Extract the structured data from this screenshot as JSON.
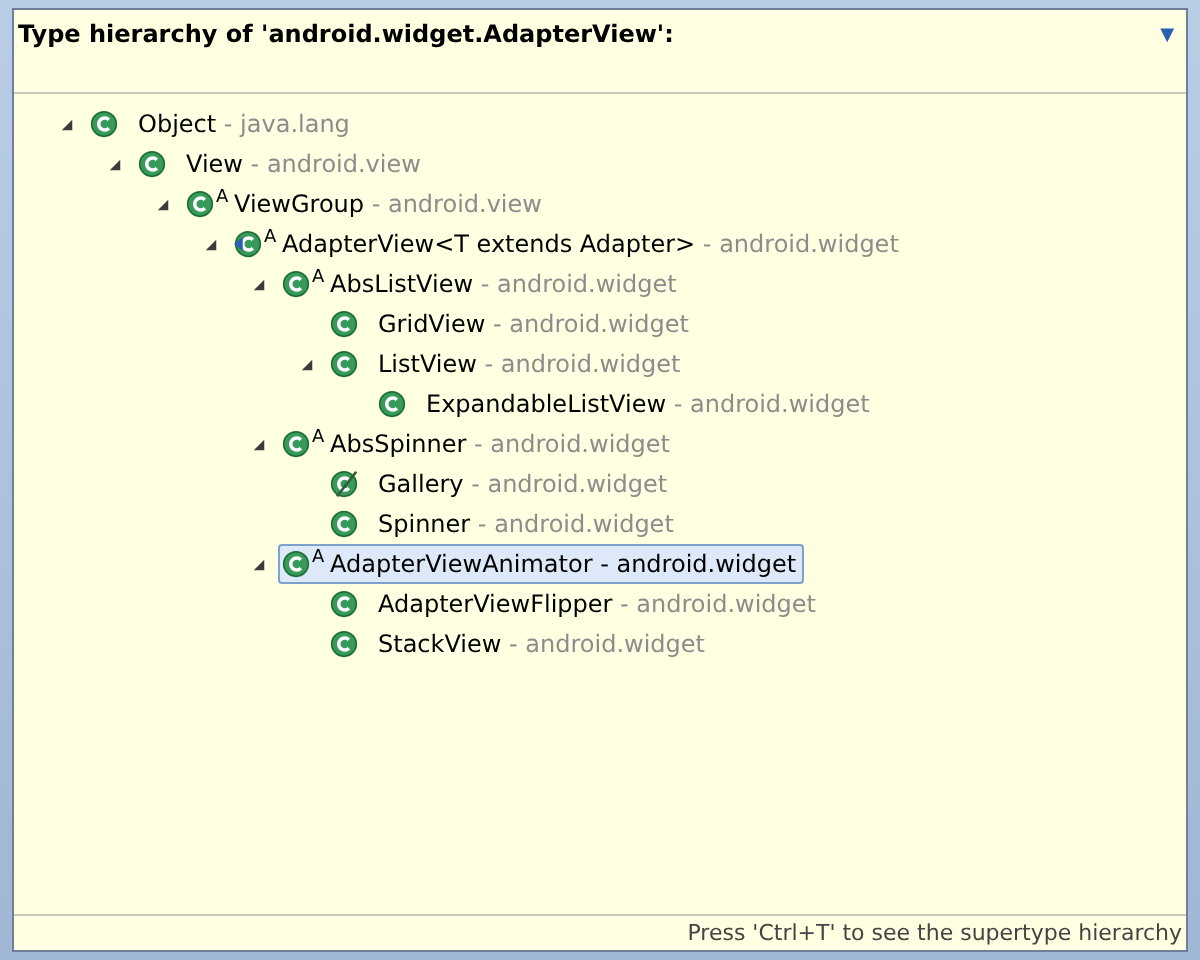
{
  "header": {
    "title": "Type hierarchy of 'android.widget.AdapterView':",
    "menu": "▼"
  },
  "tree": [
    {
      "name": "Object",
      "package": "java.lang",
      "kind": "class",
      "expanded": true,
      "selected": false,
      "children": [
        {
          "name": "View",
          "package": "android.view",
          "kind": "class",
          "expanded": true,
          "selected": false,
          "children": [
            {
              "name": "ViewGroup",
              "package": "android.view",
              "kind": "class",
              "abstract_mark": "A",
              "expanded": true,
              "selected": false,
              "children": [
                {
                  "name": "AdapterView<T extends Adapter>",
                  "package": "android.widget",
                  "kind": "focus",
                  "abstract_mark": "A",
                  "expanded": true,
                  "selected": false,
                  "children": [
                    {
                      "name": "AbsListView",
                      "package": "android.widget",
                      "kind": "class",
                      "abstract_mark": "A",
                      "expanded": true,
                      "selected": false,
                      "children": [
                        {
                          "name": "GridView",
                          "package": "android.widget",
                          "kind": "class",
                          "selected": false
                        },
                        {
                          "name": "ListView",
                          "package": "android.widget",
                          "kind": "class",
                          "expanded": true,
                          "selected": false,
                          "children": [
                            {
                              "name": "ExpandableListView",
                              "package": "android.widget",
                              "kind": "class",
                              "selected": false
                            }
                          ]
                        }
                      ]
                    },
                    {
                      "name": "AbsSpinner",
                      "package": "android.widget",
                      "kind": "class",
                      "abstract_mark": "A",
                      "expanded": true,
                      "selected": false,
                      "children": [
                        {
                          "name": "Gallery",
                          "package": "android.widget",
                          "kind": "deprecated",
                          "selected": false
                        },
                        {
                          "name": "Spinner",
                          "package": "android.widget",
                          "kind": "class",
                          "selected": false
                        }
                      ]
                    },
                    {
                      "name": "AdapterViewAnimator",
                      "package": "android.widget",
                      "kind": "class",
                      "abstract_mark": "A",
                      "expanded": true,
                      "selected": true,
                      "children": [
                        {
                          "name": "AdapterViewFlipper",
                          "package": "android.widget",
                          "kind": "class",
                          "selected": false
                        },
                        {
                          "name": "StackView",
                          "package": "android.widget",
                          "kind": "class",
                          "selected": false
                        }
                      ]
                    }
                  ]
                }
              ]
            }
          ]
        }
      ]
    }
  ],
  "separator": " - ",
  "status": "Press 'Ctrl+T' to see the supertype hierarchy"
}
